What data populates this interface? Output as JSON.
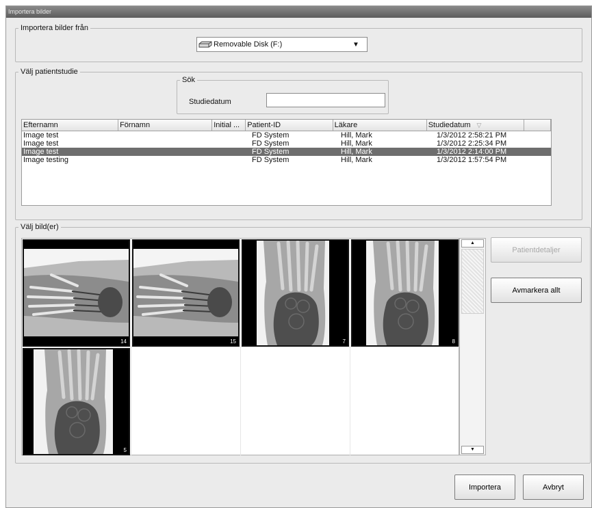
{
  "window": {
    "title": "Importera bilder"
  },
  "source": {
    "legend": "Importera bilder från",
    "selected": "Removable Disk (F:)",
    "icon": "disk-drive-icon"
  },
  "study": {
    "legend": "Välj patientstudie",
    "search_group": "Sök",
    "search_label": "Studiedatum",
    "search_value": "",
    "columns": [
      "Efternamn",
      "Förnamn",
      "Initial ...",
      "Patient-ID",
      "Läkare",
      "Studiedatum",
      ""
    ],
    "sort_column": "Studiedatum",
    "rows": [
      {
        "efternamn": "Image test",
        "fornamn": "",
        "initial": "",
        "patient_id": "FD System",
        "lakare": "Hill, Mark",
        "studiedatum": "1/3/2012 2:58:21 PM",
        "selected": false
      },
      {
        "efternamn": "Image test",
        "fornamn": "",
        "initial": "",
        "patient_id": "FD System",
        "lakare": "Hill, Mark",
        "studiedatum": "1/3/2012 2:25:34 PM",
        "selected": false
      },
      {
        "efternamn": "Image test",
        "fornamn": "",
        "initial": "",
        "patient_id": "FD System",
        "lakare": "Hill, Mark",
        "studiedatum": "1/3/2012 2:14:00 PM",
        "selected": true
      },
      {
        "efternamn": "Image testing",
        "fornamn": "",
        "initial": "",
        "patient_id": "FD System",
        "lakare": "Hill, Mark",
        "studiedatum": "1/3/2012 1:57:54 PM",
        "selected": false
      }
    ]
  },
  "images": {
    "legend": "Välj bild(er)",
    "thumbnails": [
      {
        "number": "14",
        "kind": "hand-xray",
        "selected": true
      },
      {
        "number": "15",
        "kind": "hand-xray",
        "selected": true
      },
      {
        "number": "7",
        "kind": "foot-xray",
        "selected": true
      },
      {
        "number": "8",
        "kind": "foot-xray",
        "selected": true
      },
      {
        "number": "5",
        "kind": "foot-xray",
        "selected": true
      }
    ]
  },
  "actions": {
    "patient_details": "Patientdetaljer",
    "deselect_all": "Avmarkera allt",
    "import": "Importera",
    "cancel": "Avbryt"
  }
}
